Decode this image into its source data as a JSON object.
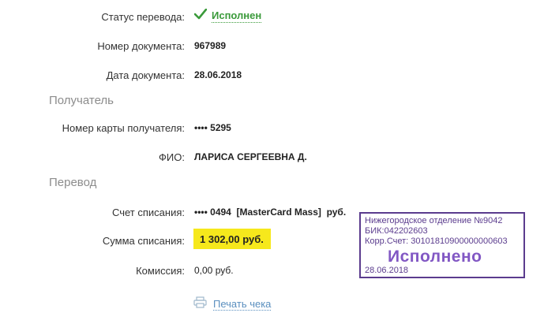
{
  "status": {
    "label": "Статус перевода:",
    "value": "Исполнен"
  },
  "document": {
    "number_label": "Номер документа:",
    "number": "967989",
    "date_label": "Дата документа:",
    "date": "28.06.2018"
  },
  "recipient": {
    "section_title": "Получатель",
    "card_label": "Номер карты получателя:",
    "card": "•••• 5295",
    "name_label": "ФИО:",
    "name": "ЛАРИСА СЕРГЕЕВНА Д."
  },
  "transfer": {
    "section_title": "Перевод",
    "account_label": "Счет списания:",
    "account_number": "•••• 0494",
    "account_name": "[MasterCard Mass]",
    "account_currency": "руб.",
    "amount_label": "Сумма списания:",
    "amount": "1 302,00 руб.",
    "fee_label": "Комиссия:",
    "fee": "0,00 руб."
  },
  "print": {
    "label": "Печать чека"
  },
  "stamp": {
    "line1": "Нижегородское отделение №9042",
    "line2": "БИК:042202603",
    "line3": "Корр.Счет: 30101810900000000603",
    "status": "Исполнено",
    "date": "28.06.2018"
  },
  "colors": {
    "success": "#3a9a3a",
    "link": "#5a8fbf",
    "highlight": "#f6e81c",
    "stamp": "#5b3c8e"
  }
}
